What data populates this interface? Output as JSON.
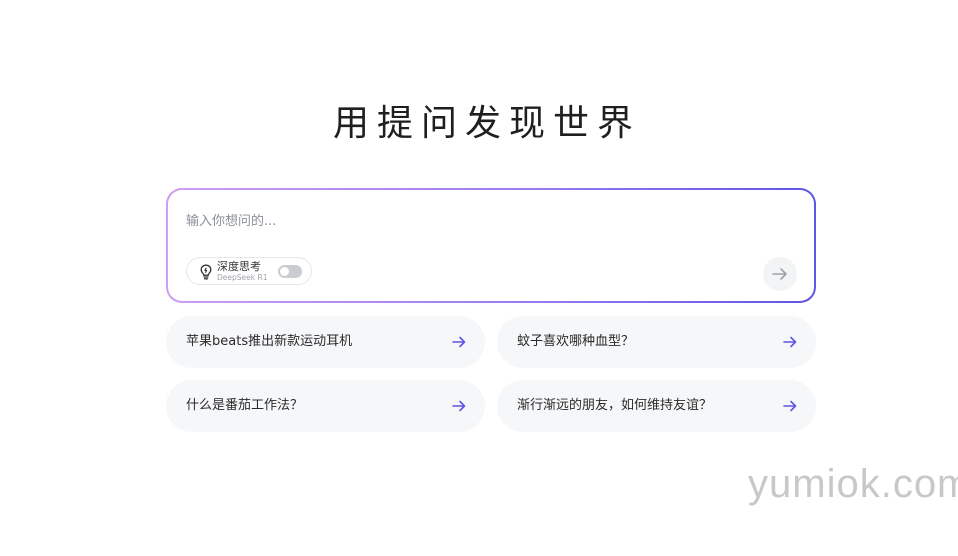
{
  "hero": {
    "title": "用提问发现世界"
  },
  "input": {
    "placeholder": "输入你想问的...",
    "deep_think": {
      "icon": "lightbulb-icon",
      "label": "深度思考",
      "sublabel": "DeepSeek R1",
      "enabled": false
    },
    "send_icon": "arrow-right-icon"
  },
  "suggestions": [
    {
      "text": "苹果beats推出新款运动耳机",
      "icon": "arrow-right-icon"
    },
    {
      "text": "蚊子喜欢哪种血型？",
      "icon": "arrow-right-icon"
    },
    {
      "text": "什么是番茄工作法？",
      "icon": "arrow-right-icon"
    },
    {
      "text": "渐行渐远的朋友，如何维持友谊？",
      "icon": "arrow-right-icon"
    }
  ],
  "watermark": "yumiok.com",
  "colors": {
    "accent": "#5f55e6",
    "gradient_start": "#cf9ef0",
    "gradient_end": "#5f55e6",
    "suggestion_bg": "#f6f7f9"
  }
}
